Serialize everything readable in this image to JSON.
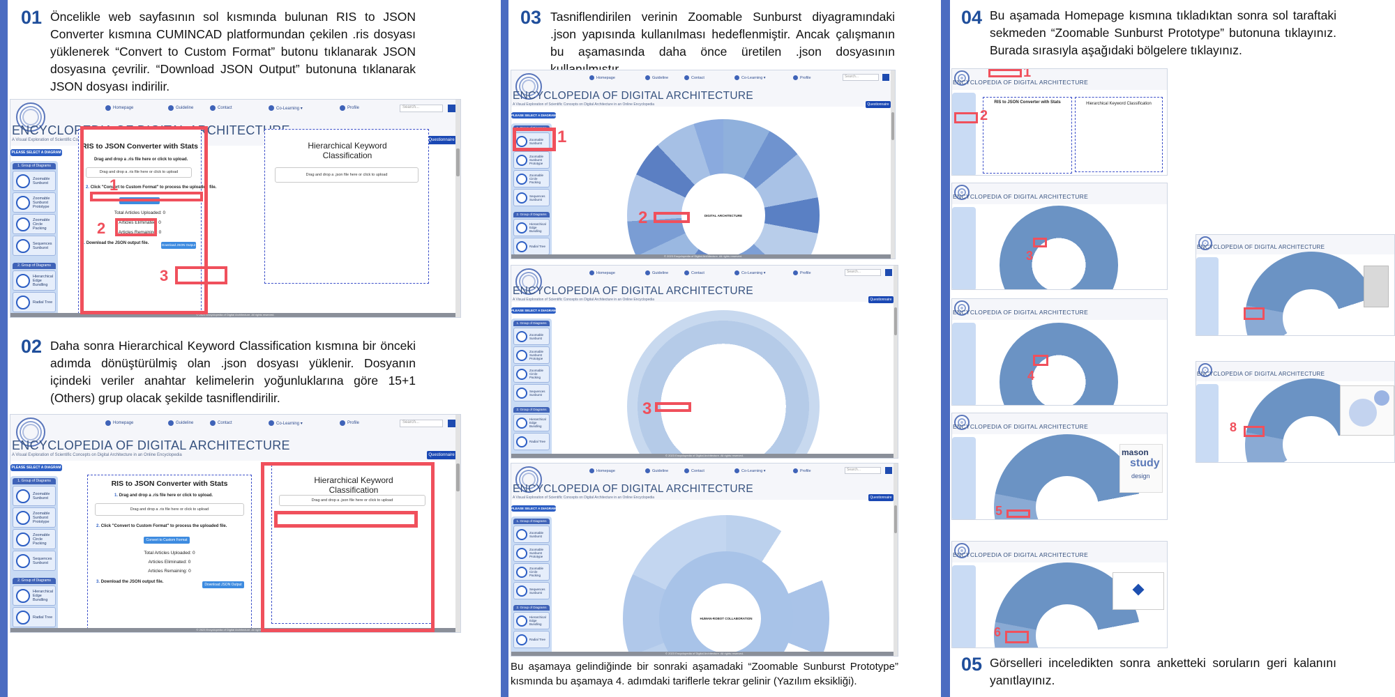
{
  "steps": [
    {
      "num": "01",
      "text": "Öncelikle web sayfasının sol kısmında bulunan RIS to JSON Converter kısmına CUMINCAD platformundan çekilen .ris dosyası yüklenerek “Convert to Custom Format” butonu tıklanarak JSON dosyasına çevrilir. “Download JSON Output” butonuna tıklanarak JSON dosyası indirilir."
    },
    {
      "num": "02",
      "text": "Daha sonra Hierarchical Keyword Classification kısmına bir önceki adımda dönüştürülmiş olan .json dosyası yüklenir. Dosyanın içindeki veriler anahtar kelimelerin yoğunluklarına göre 15+1 (Others) grup olacak şekilde tasniflendirilir."
    },
    {
      "num": "03",
      "text": "Tasniflendirilen verinin Zoomable Sunburst diyagramındaki .json yapısında kullanılması hedeflenmiştir. Ancak çalışmanın bu aşamasında daha önce üretilen .json dosyasının kullanılmıştır."
    },
    {
      "num": "04",
      "text": "Bu aşamada Homepage kısmına tıkladıktan sonra sol taraftaki sekmeden “Zoomable Sunburst Prototype” butonuna tıklayınız. Burada sırasıyla aşağıdaki bölgelere tıklayınız."
    },
    {
      "num": "05",
      "text": "Görselleri inceledikten sonra anketteki soruların geri kalanını yanıtlayınız."
    }
  ],
  "caption03": "Bu aşamaya gelindiğinde bir sonraki aşamadaki “Zoomable Sunburst Prototype” kısmında bu aşamaya 4. adımdaki tariflerle tekrar gelinir (Yazılım eksikliği).",
  "site": {
    "nav": [
      "Homepage",
      "Guideline",
      "Contact",
      "Co-Learning ▾",
      "Profile"
    ],
    "search_placeholder": "Search...",
    "brand": "ENCYCLOPEDIA OF DIGITAL ARCHITECTURE",
    "subtitle": "A Visual Exploration of Scientific Concepts on Digital Architecture in an Online Encyclopedia",
    "questionnaire": "Questionnaire",
    "please_select": "PLEASE SELECT A DIAGRAM",
    "group1": "1. Group of Diagrams",
    "group2": "2. Group of Diagrams",
    "items1": [
      "Zoomable Sunburst",
      "Zoomable Sunburst Prototype",
      "Zoomable Circle Packing",
      "Sequences Sunburst"
    ],
    "items2": [
      "Hierarchical Edge Bundling",
      "Radial Tree"
    ],
    "footer": "© 2023 Encyclopedia of Digital Architecture. All rights reserved."
  },
  "converter": {
    "title": "RIS to JSON Converter with Stats",
    "step1": "Drag and drop a .ris file here or click to upload.",
    "drop1": "Drag and drop a .ris file here or click to upload",
    "step2": "Click \"Convert to Custom Format\" to process the uploaded file.",
    "convert_btn": "Convert to Custom Format",
    "stat1": "Total Articles Uploaded: 0",
    "stat2": "Articles Eliminated: 0",
    "stat3": "Articles Remaining: 0",
    "step3": "Download the JSON output file.",
    "download_btn": "Download JSON Output"
  },
  "hkc": {
    "title": "Hierarchical Keyword Classification",
    "drop": "Drag and drop a .json file here or click to upload"
  },
  "sunburst": {
    "center1": "DIGITAL ARCHITECTURE",
    "center3": "HUMAN-ROBOT COLLABORATION"
  },
  "wordcloud": [
    "mason",
    "study",
    "design"
  ],
  "markers": {
    "s1": [
      "1",
      "2",
      "3"
    ],
    "s3": [
      "1",
      "2",
      "3"
    ],
    "s4": [
      "1",
      "2",
      "3",
      "4",
      "5",
      "6",
      "8"
    ]
  },
  "colors": {
    "accent_bar": "#4b6cc1",
    "highlight": "#f0505c",
    "step_number": "#1f4e9b",
    "sunburst": "#6b93c4"
  }
}
